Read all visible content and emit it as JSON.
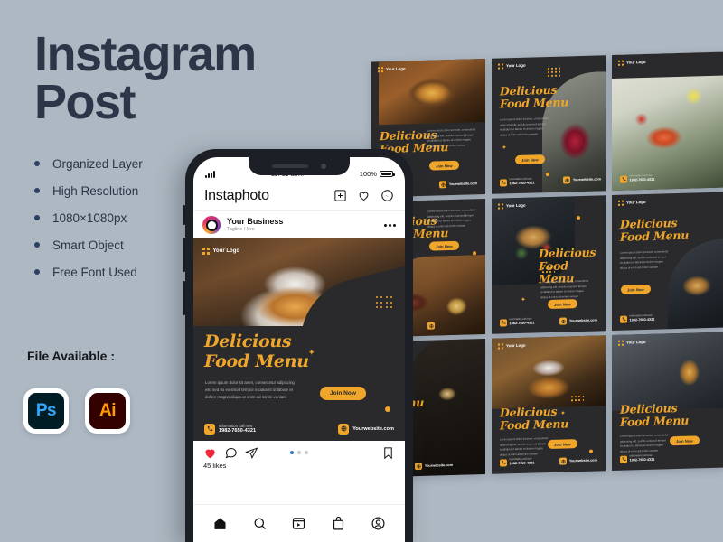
{
  "page": {
    "title_line1": "Instagram",
    "title_line2": "Post",
    "bg_color": "#aeb8c2",
    "title_color": "#2b3648",
    "accent_color": "#f0a62a"
  },
  "features": [
    {
      "label": "Organized Layer"
    },
    {
      "label": "High Resolution"
    },
    {
      "label": "1080×1080px"
    },
    {
      "label": "Smart Object"
    },
    {
      "label": "Free Font Used"
    }
  ],
  "file_available": {
    "label": "File Available :",
    "apps": [
      {
        "name": "photoshop",
        "glyph": "Ps",
        "bg": "#001d26",
        "fg": "#31a8ff"
      },
      {
        "name": "illustrator",
        "glyph": "Ai",
        "bg": "#330000",
        "fg": "#ff9a00"
      }
    ]
  },
  "phone": {
    "statusbar": {
      "time": "11: 11 a.m.",
      "battery": "100%"
    },
    "app_header": {
      "logo": "Instaphoto",
      "icons": [
        "plus-box-icon",
        "heart-icon",
        "messenger-icon"
      ]
    },
    "post_user": {
      "name": "Your Business",
      "tagline": "Tagline Here",
      "menu": "more-options-icon"
    },
    "post": {
      "logo_text": "Your Logo",
      "title_line1": "Delicious",
      "title_line2": "Food Menu",
      "body": "Lorem ipsum dolor sit amet, consectetur adipiscing elit, sed do eiusmod tempor incididunt ut labore et dolore magna aliqua ut enim ad minim veniam",
      "cta": "Join Now",
      "call_label": "Information call now",
      "call_number": "1982-7650-4321",
      "website": "Yourwebsite.com"
    },
    "actions": {
      "like": "heart-filled-icon",
      "comment": "comment-icon",
      "share": "share-icon",
      "save": "bookmark-icon"
    },
    "likes": "45 likes",
    "carousel_dots": 3,
    "carousel_active": 0,
    "bottom_nav": [
      "home-icon",
      "search-icon",
      "reels-icon",
      "shop-icon",
      "profile-icon"
    ]
  },
  "card_defaults": {
    "logo_text": "Your Logo",
    "title_line1": "Delicious",
    "title_line2": "Food Menu",
    "body": "Lorem ipsum dolor sit amet, consectetur adipiscing elit, sed do eiusmod tempor incididunt ut labore et dolore magna aliqua ut enim ad minim veniam",
    "cta": "Join Now",
    "call_label": "Information call now",
    "call_number": "1982-7650-4321",
    "website": "Yourwebsite.com"
  },
  "cards": [
    {
      "id": 1,
      "photo": "ph-bowl",
      "layout": "top-image"
    },
    {
      "id": 2,
      "photo": "ph-drink",
      "layout": "right-image"
    },
    {
      "id": 3,
      "photo": "ph-salad",
      "layout": "full-image"
    },
    {
      "id": 4,
      "photo": "ph-steak",
      "layout": "bottom-image"
    },
    {
      "id": 5,
      "photo": "ph-plate",
      "layout": "left-image"
    },
    {
      "id": 6,
      "photo": "ph-burger",
      "layout": "right-image"
    },
    {
      "id": 7,
      "photo": "ph-cocktail",
      "layout": "right-image"
    },
    {
      "id": 8,
      "photo": "ph-chicken",
      "layout": "top-image"
    },
    {
      "id": 9,
      "photo": "ph-coffee",
      "layout": "top-image"
    }
  ]
}
